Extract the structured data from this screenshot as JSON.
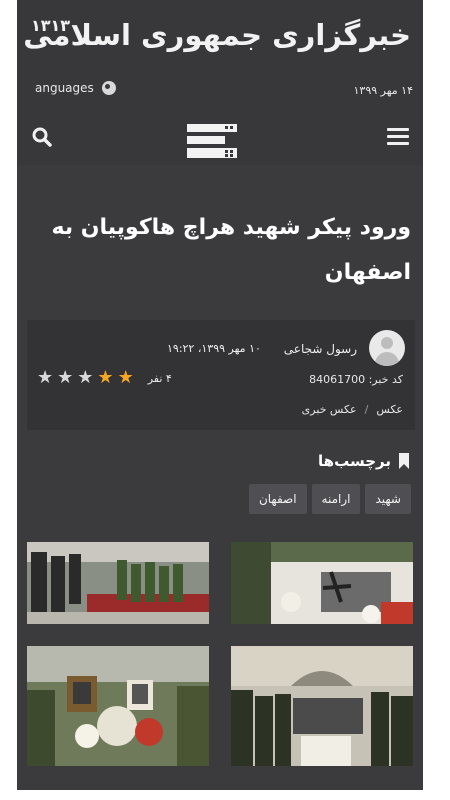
{
  "header": {
    "site_name": "خبرگزاری جمهوری اسلامی",
    "year": "۱۳۱۳",
    "date": "۱۴ مهر ۱۳۹۹",
    "languages_label": "anguages",
    "icons": [
      "globe-icon",
      "search-icon",
      "menu-icon",
      "site-logo"
    ]
  },
  "article": {
    "headline": "ورود پیکر شهید هراچ هاکوپیان به اصفهان",
    "author": "رسول شجاعی",
    "published": "۱۰ مهر ۱۳۹۹، ۱۹:۲۲",
    "news_code": "کد خبر: 84061700",
    "rating": {
      "votes_label": "۴ نفر",
      "stars_filled": 2,
      "stars_total": 5
    },
    "breadcrumbs": [
      "عکس",
      "عکس خبری"
    ]
  },
  "tags": {
    "heading": "برچسب‌ها",
    "items": [
      "شهید",
      "ارامنه",
      "اصفهان"
    ]
  },
  "colors": {
    "background": "#3b3b3e",
    "header": "#38383b",
    "star_on": "#f5a623",
    "star_off": "#d9d9d9",
    "tag_bg": "#4f4f53"
  }
}
